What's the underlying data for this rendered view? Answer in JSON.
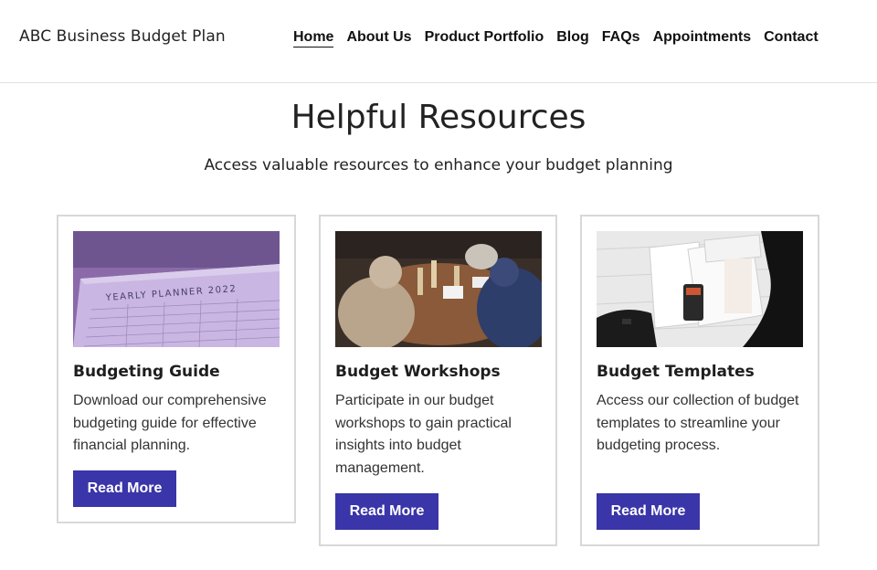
{
  "header": {
    "brand": "ABC Business Budget Plan",
    "nav": [
      "Home",
      "About Us",
      "Product Portfolio",
      "Blog",
      "FAQs",
      "Appointments",
      "Contact"
    ],
    "active_nav": "Home"
  },
  "hero": {
    "title": "Helpful Resources",
    "subtitle": "Access valuable resources to enhance your budget planning"
  },
  "cards": [
    {
      "title": "Budgeting Guide",
      "text": "Download our comprehensive budgeting guide for effective financial planning.",
      "button": "Read More",
      "image_label": "YEARLY PLANNER 2022"
    },
    {
      "title": "Budget Workshops",
      "text": "Participate in our budget workshops to gain practical insights into budget management.",
      "button": "Read More"
    },
    {
      "title": "Budget Templates",
      "text": "Access our collection of budget templates to streamline your budgeting process.",
      "button": "Read More"
    }
  ],
  "colors": {
    "button": "#3a35a8",
    "card_border": "#d8d8d8"
  }
}
